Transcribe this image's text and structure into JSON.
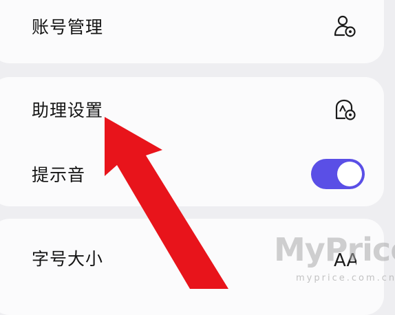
{
  "colors": {
    "background": "#eeeef1",
    "card": "#fbfbfc",
    "toggle_on": "#5a4fe6",
    "annotation_arrow": "#e8141b"
  },
  "settings": {
    "account_management": {
      "label": "账号管理",
      "icon": "user-settings-icon"
    },
    "assistant_settings": {
      "label": "助理设置",
      "icon": "assistant-settings-icon"
    },
    "notification_sound": {
      "label": "提示音",
      "toggle_on": true
    },
    "font_size": {
      "label": "字号大小",
      "icon": "font-size-icon",
      "icon_text": "AA"
    }
  },
  "watermark": {
    "brand": "MyPrice",
    "domain": "myprice.com.cn"
  }
}
